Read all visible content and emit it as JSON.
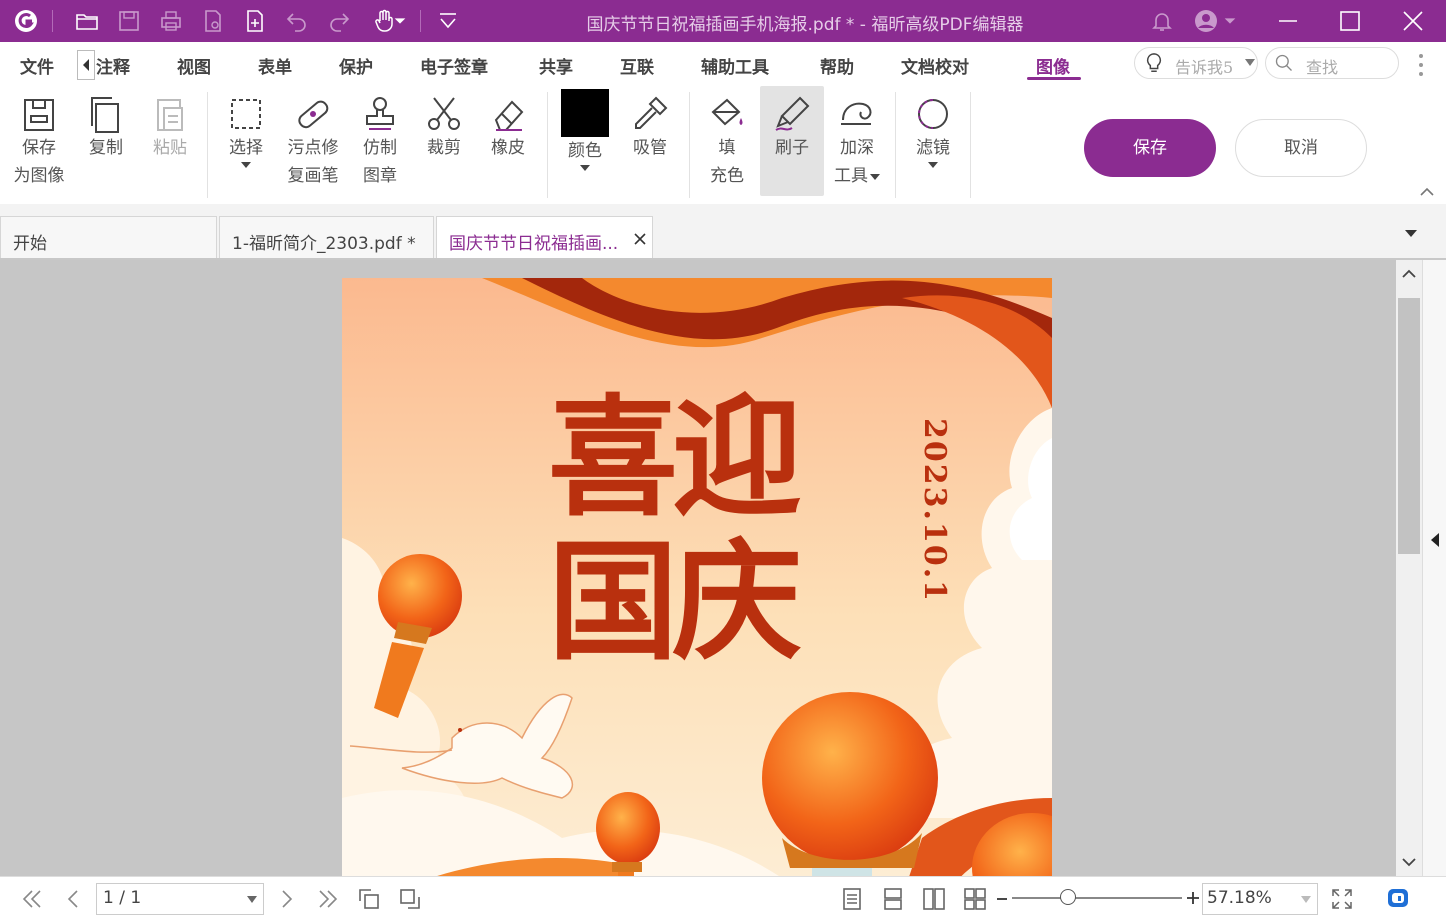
{
  "window": {
    "title": "国庆节节日祝福插画手机海报.pdf * - 福昕高级PDF编辑器"
  },
  "menu": {
    "items": [
      "文件",
      "注释",
      "视图",
      "表单",
      "保护",
      "电子签章",
      "共享",
      "互联",
      "辅助工具",
      "帮助",
      "文档校对",
      "图像"
    ],
    "active": "图像",
    "tellme_placeholder": "告诉我5",
    "search_placeholder": "查找"
  },
  "ribbon": {
    "save_as_image": [
      "保存",
      "为图像"
    ],
    "copy": "复制",
    "paste": "粘贴",
    "select": "选择",
    "spot_heal": [
      "污点修",
      "复画笔"
    ],
    "clone_stamp": [
      "仿制",
      "图章"
    ],
    "crop": "裁剪",
    "eraser": "橡皮",
    "color": "颜色",
    "eyedropper": "吸管",
    "fill": [
      "填",
      "充色"
    ],
    "brush": "刷子",
    "burn": [
      "加深",
      "工具"
    ],
    "filter": "滤镜",
    "save_button": "保存",
    "cancel_button": "取消",
    "current_color": "#000000"
  },
  "tabs": [
    {
      "label": "开始"
    },
    {
      "label": "1-福昕简介_2303.pdf *"
    },
    {
      "label": "国庆节节日祝福插画..."
    }
  ],
  "poster": {
    "title_line1": "喜迎",
    "title_line2": "国庆",
    "date": "2023.10.1"
  },
  "statusbar": {
    "page_indicator": "1 / 1",
    "zoom": "57.18%",
    "zoom_slider_fraction": 0.33
  },
  "colors": {
    "brand": "#8b2c91",
    "poster_red": "#b9300e"
  }
}
